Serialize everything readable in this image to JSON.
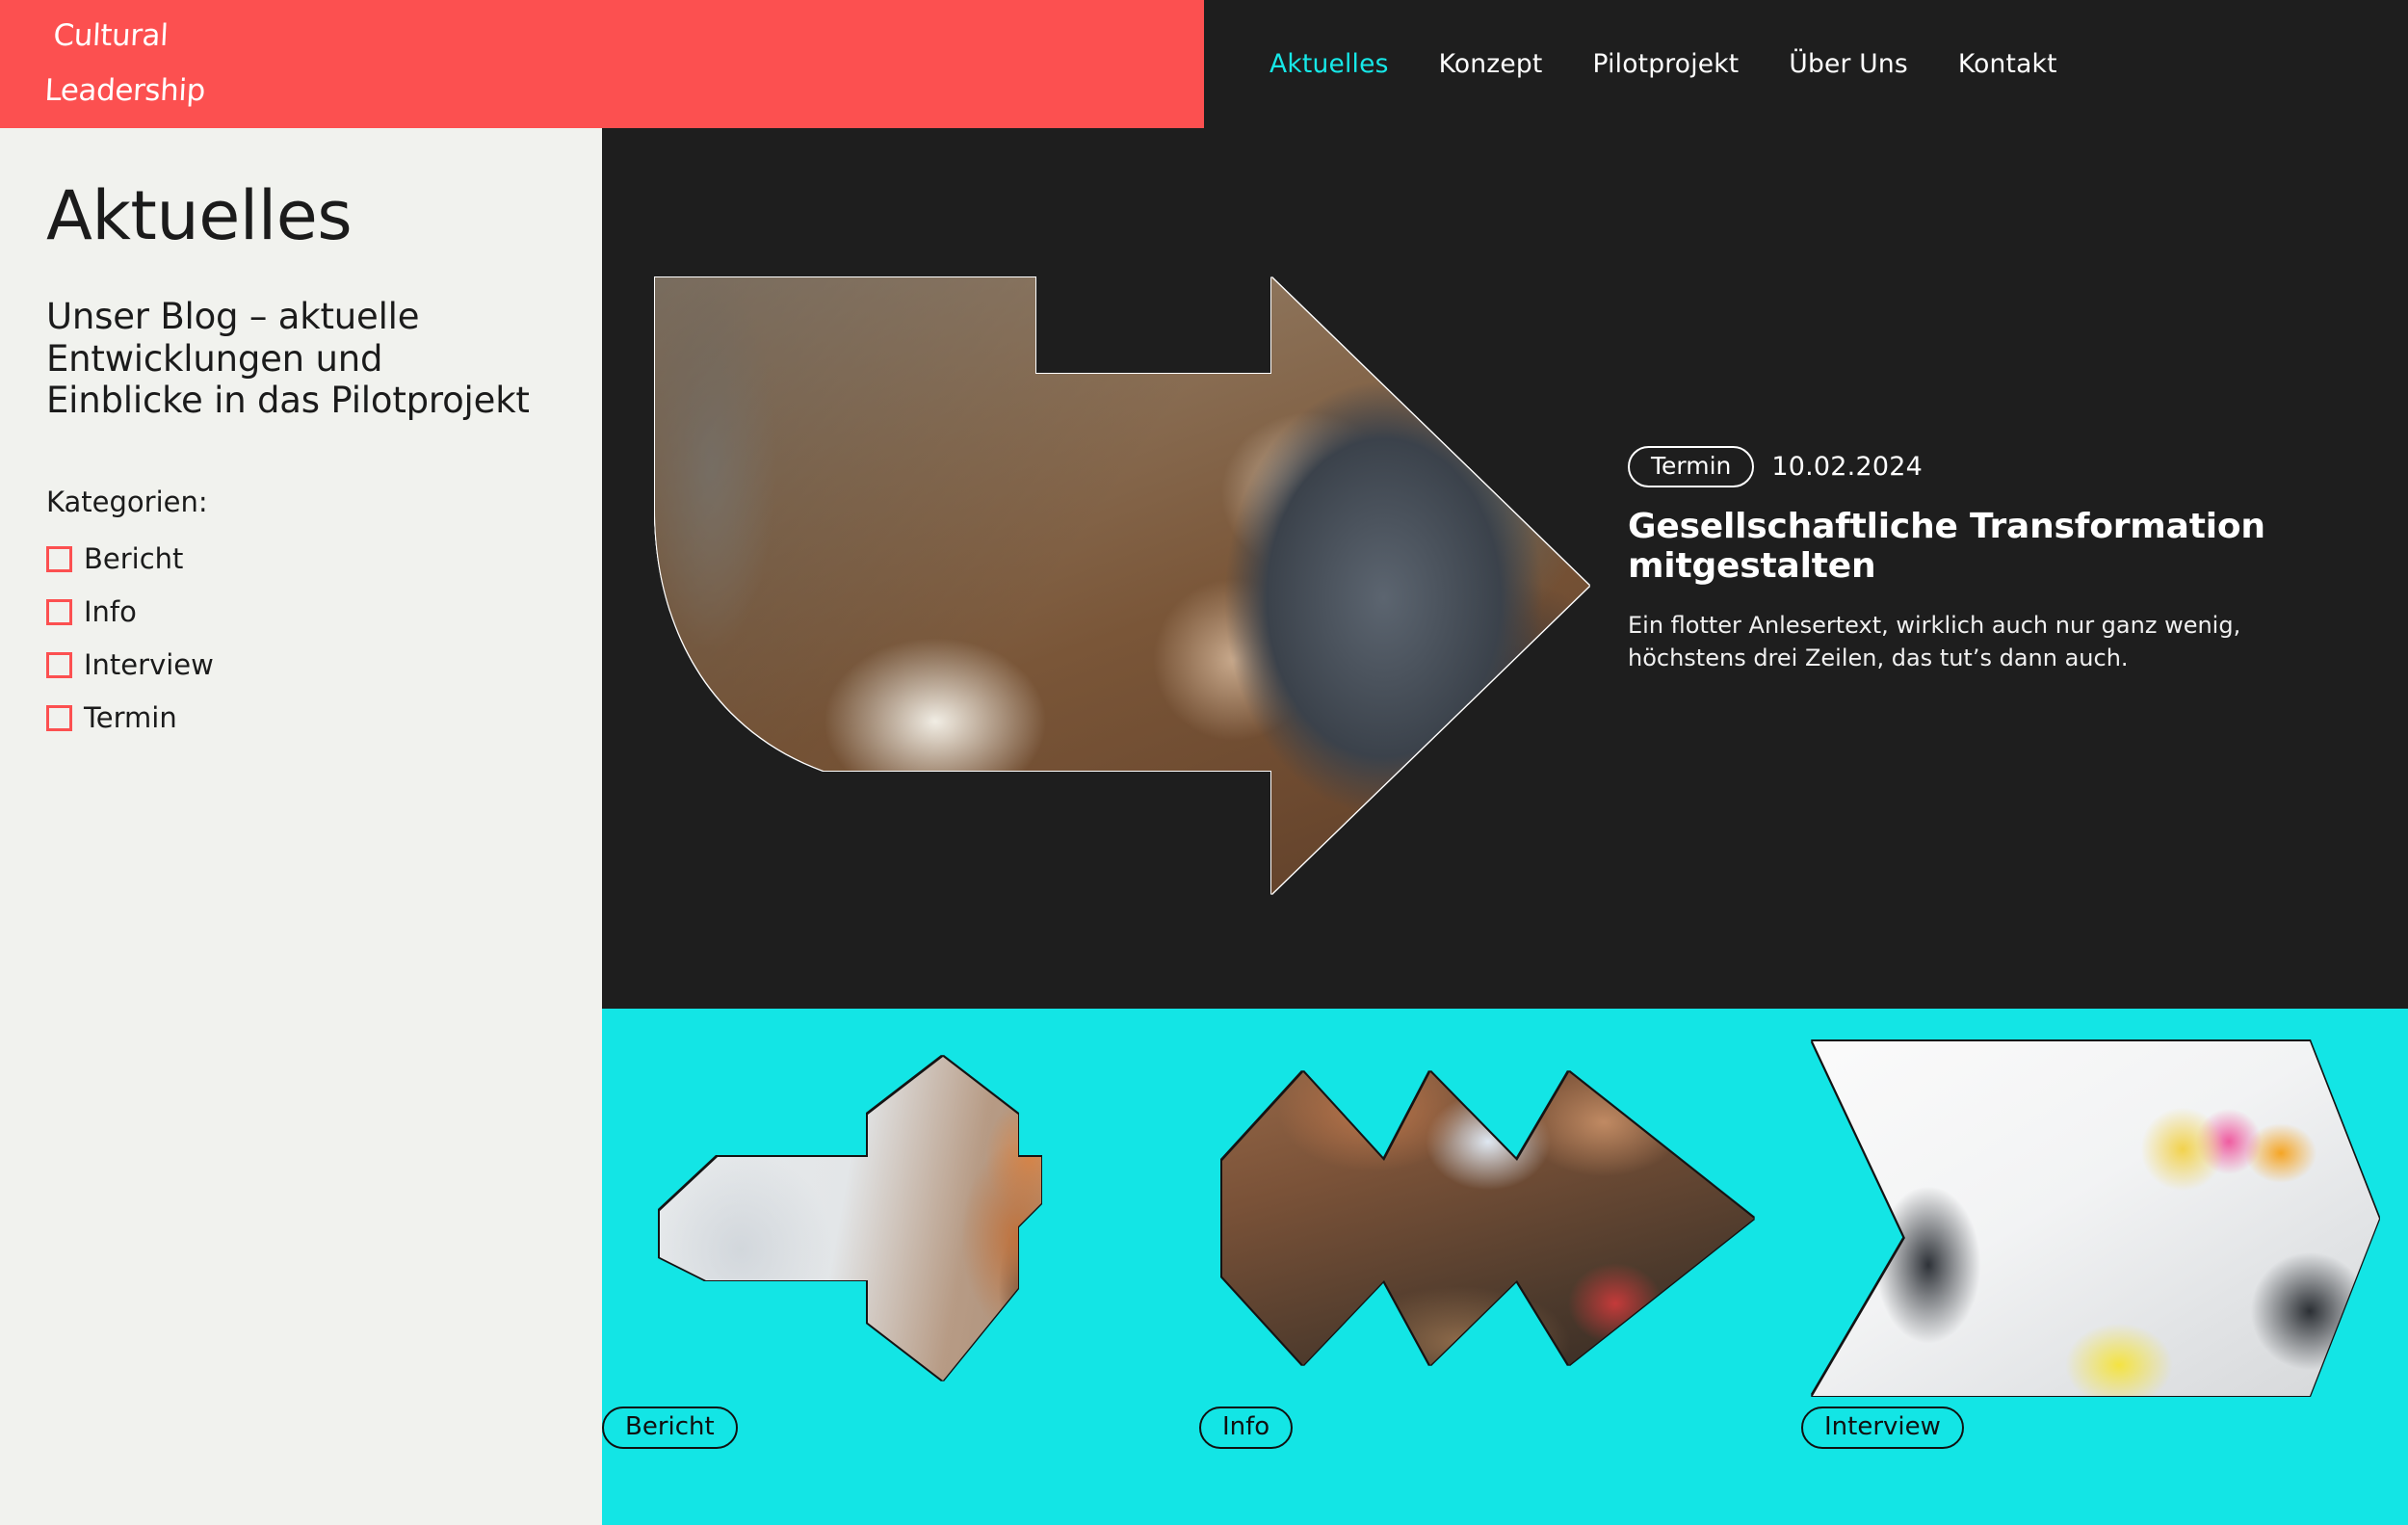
{
  "brand": {
    "logo_line1": "Cultural",
    "logo_line2": "Leadership"
  },
  "colors": {
    "brand_red": "#fc5050",
    "accent_cyan": "#13e5e5",
    "dark": "#1e1e1e",
    "offwhite": "#f1f2ee"
  },
  "nav": {
    "items": [
      {
        "label": "Aktuelles",
        "active": true
      },
      {
        "label": "Konzept",
        "active": false
      },
      {
        "label": "Pilotprojekt",
        "active": false
      },
      {
        "label": "Über Uns",
        "active": false
      },
      {
        "label": "Kontakt",
        "active": false
      }
    ]
  },
  "sidebar": {
    "title": "Aktuelles",
    "intro": "Unser Blog – aktuelle Entwicklungen und Einblicke in das Pilotprojekt",
    "categories_heading": "Kategorien:",
    "categories": [
      {
        "label": "Bericht",
        "checked": false
      },
      {
        "label": "Info",
        "checked": false
      },
      {
        "label": "Interview",
        "checked": false
      },
      {
        "label": "Termin",
        "checked": false
      }
    ]
  },
  "feature": {
    "tag": "Termin",
    "date": "10.02.2024",
    "title": "Gesellschaftliche Transformation mitgestalten",
    "lead": "Ein flotter Anlesertext, wirklich auch  nur ganz wenig, höchstens drei Zeilen, das tut’s dann auch.",
    "image_alt": "arrow-shaped-photo-meeting-table"
  },
  "cards": [
    {
      "tag": "Bericht",
      "image_alt": "arrow-shaped-photo-woman-presenting"
    },
    {
      "tag": "Info",
      "image_alt": "zigzag-shaped-photo-conference-audience"
    },
    {
      "tag": "Interview",
      "image_alt": "hexagon-shaped-photo-workshop-stickynotes"
    }
  ]
}
